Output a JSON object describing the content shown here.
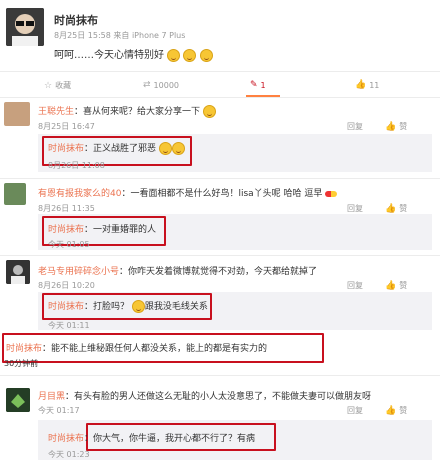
{
  "post": {
    "author": "时尚抹布",
    "meta": "8月25日 15:58 来自 iPhone 7 Plus",
    "text": "呵呵……今天心情特别好",
    "actions": [
      {
        "icon": "bookmark-icon",
        "label": "收藏"
      },
      {
        "icon": "repost-icon",
        "label": "10000"
      },
      {
        "icon": "comment-icon",
        "label": "1"
      },
      {
        "icon": "like-icon",
        "label": "11"
      }
    ]
  },
  "comments": [
    {
      "user": "王聪先生",
      "text": "喜从何来呢？给大家分享一下",
      "time": "8月25日 16:47",
      "reply_user": "时尚抹布",
      "reply_text": "正义战胜了邪恶",
      "reply_time": "8月26日 11:08"
    },
    {
      "user": "有恩有报我家么的40",
      "text": "一看面相都不是什么好鸟！lisa丫头呢 哈哈 逗早",
      "time": "8月26日 11:35",
      "reply_user": "时尚抹布",
      "reply_text": "一对重婚罪的人",
      "reply_time": "今天 01:05"
    },
    {
      "user": "老马专用碎碎念小号",
      "text": "你咋天发着微博就觉得不对劲，今天都给就掉了",
      "time": "8月26日 10:20",
      "reply_user": "时尚抹布",
      "reply_text": "打脸吗？",
      "reply_text2": "跟我没毛线关系",
      "reply_time": "今天 01:11"
    },
    {
      "user": "时尚抹布",
      "text": "能不能上维秘跟任何人都没关系，能上的都是有实力的",
      "time": "30分钟前"
    },
    {
      "user": "月目黑",
      "text": "有头有脸的男人还做这么无耻的小人太没意思了，不能做夫妻可以做朋友呀",
      "time": "今天 01:17",
      "reply_user": "时尚抹布",
      "reply_text": "你大气，你牛逼，我开心都不行了？有病",
      "reply_time": "今天 01:23"
    }
  ],
  "comment_actions": [
    "回复",
    "赞"
  ]
}
